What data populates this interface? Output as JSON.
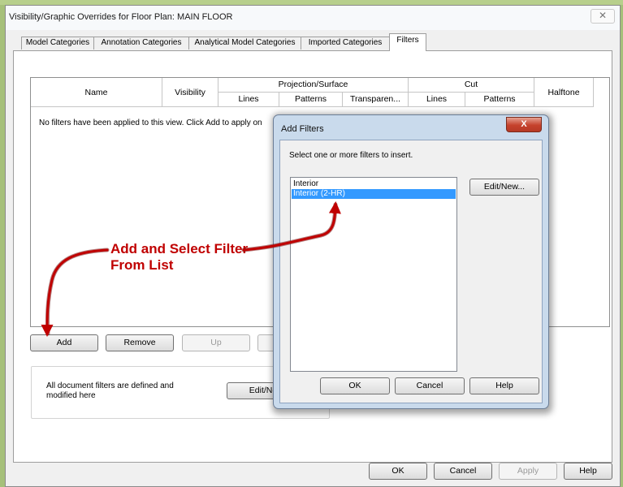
{
  "window": {
    "title": "Visibility/Graphic Overrides for Floor Plan: MAIN FLOOR",
    "close_glyph": "✕"
  },
  "tabs": [
    {
      "label": "Model Categories"
    },
    {
      "label": "Annotation Categories"
    },
    {
      "label": "Analytical Model Categories"
    },
    {
      "label": "Imported Categories"
    },
    {
      "label": "Filters"
    }
  ],
  "filters_table": {
    "col_name": "Name",
    "col_visibility": "Visibility",
    "group_projection": "Projection/Surface",
    "proj_lines": "Lines",
    "proj_patterns": "Patterns",
    "proj_transparency": "Transparen...",
    "group_cut": "Cut",
    "cut_lines": "Lines",
    "cut_patterns": "Patterns",
    "col_halftone": "Halftone",
    "empty_message": "No filters have been applied to this view. Click Add to apply on"
  },
  "row_buttons": {
    "add": "Add",
    "remove": "Remove",
    "up": "Up"
  },
  "doc_filters": {
    "text": "All document filters are defined and modified here",
    "edit_new": "Edit/Ne"
  },
  "dialog_buttons": {
    "ok": "OK",
    "cancel": "Cancel",
    "apply": "Apply",
    "help": "Help"
  },
  "add_filters": {
    "title": "Add Filters",
    "close_glyph": "X",
    "prompt": "Select one or more filters to insert.",
    "items": [
      {
        "label": "Interior",
        "selected": false
      },
      {
        "label": "Interior (2-HR)",
        "selected": true
      }
    ],
    "edit_new": "Edit/New...",
    "ok": "OK",
    "cancel": "Cancel",
    "help": "Help"
  },
  "annotation": {
    "text": "Add and Select Filter From List",
    "color": "#c00000"
  },
  "colors": {
    "selection": "#3399ff",
    "popup_frame": "#c9daec",
    "close_red": "#c5412c"
  }
}
